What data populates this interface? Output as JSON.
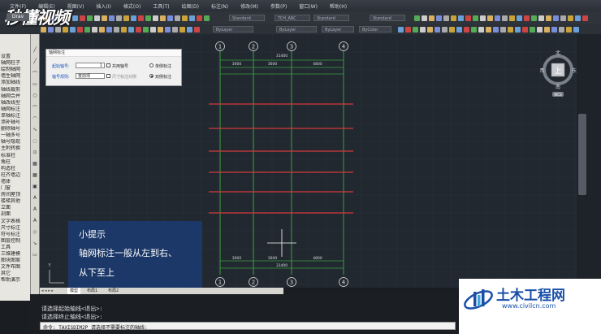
{
  "app": {
    "document_tab": "Drav",
    "menu": [
      "文件(F)",
      "编辑(E)",
      "视图(V)",
      "插入(I)",
      "格式(O)",
      "工具(T)",
      "绘图(D)",
      "标注(N)",
      "修改(M)",
      "参数(P)",
      "窗口(W)",
      "帮助(H)"
    ],
    "logo_text": "秒懂视频"
  },
  "toolbar": {
    "layer_combo": "ByLayer",
    "linetype_combo": "ByLayer",
    "lineweight_combo": "ByLayer",
    "plotstyle_combo": "ByColor",
    "textstyle_combo": "Standard",
    "dimstyle_combo": "TCH_ARC",
    "tablestyle_combo": "Standard",
    "mlstyle_combo": "Standard",
    "workspace_label": "绘图"
  },
  "left_panel": {
    "items": [
      "设置",
      "轴网柱子",
      "绘制轴网",
      "墙生轴网",
      "添加轴线",
      "轴线裁剪",
      "轴网合并",
      "轴改线型",
      "轴网标注",
      "单轴标注",
      "添补轴号",
      "删除轴号",
      "一轴多号",
      "轴号隐现",
      "主附转换",
      "标准柱",
      "角柱",
      "构造柱",
      "柱齐墙边",
      "墙体",
      "门窗",
      "房间屋顶",
      "楼梯其他",
      "立面",
      "剖面",
      "文字表格",
      "尺寸标注",
      "符号标注",
      "图层控制",
      "工具",
      "三维建模",
      "图块图案",
      "文件布图",
      "其它",
      "帮助演示"
    ]
  },
  "dialog": {
    "title": "轴网标注",
    "start_axis_label": "起始轴号:",
    "start_axis_value": "1",
    "shared_axis_label": "共用轴号",
    "single_side_label": "单侧标注",
    "axis_rule_label": "轴号规则:",
    "axis_rule_value": "变前项",
    "size_label": "尺寸标注对侧",
    "double_side_label": "双侧标注"
  },
  "drawing": {
    "axis_numbers_top": [
      "1",
      "2",
      "3",
      "4"
    ],
    "axis_numbers_bottom": [
      "1",
      "2",
      "3",
      "4"
    ],
    "top_total": "31400",
    "top_dims": [
      "3000",
      "3600",
      "4800"
    ],
    "bottom_total": "31400",
    "bottom_dims": [
      "3000",
      "3600",
      "4800"
    ]
  },
  "compass": {
    "north": "北",
    "south": "南",
    "east": "东",
    "west": "西",
    "center": "上",
    "wcs": "WCS"
  },
  "tip": {
    "title": "小提示",
    "line1": "轴网标注一般从左到右、",
    "line2": "从下至上"
  },
  "layout_tabs": {
    "model": "模型",
    "layout1": "布局1",
    "layout2": "布局2"
  },
  "command": {
    "line1": "请选择起始轴线<退出>:",
    "line2": "请选择终止轴线<退出>:",
    "input": "命令: TAXISDIM2P 请选择不需要标注的轴线:"
  },
  "watermark": {
    "title": "土木工程网",
    "url": "www.civilcn.com"
  },
  "colors": {
    "grid_line": "#3a9e3a",
    "beam_line": "#d23a3a",
    "tip_bg": "#1c3a6e"
  }
}
